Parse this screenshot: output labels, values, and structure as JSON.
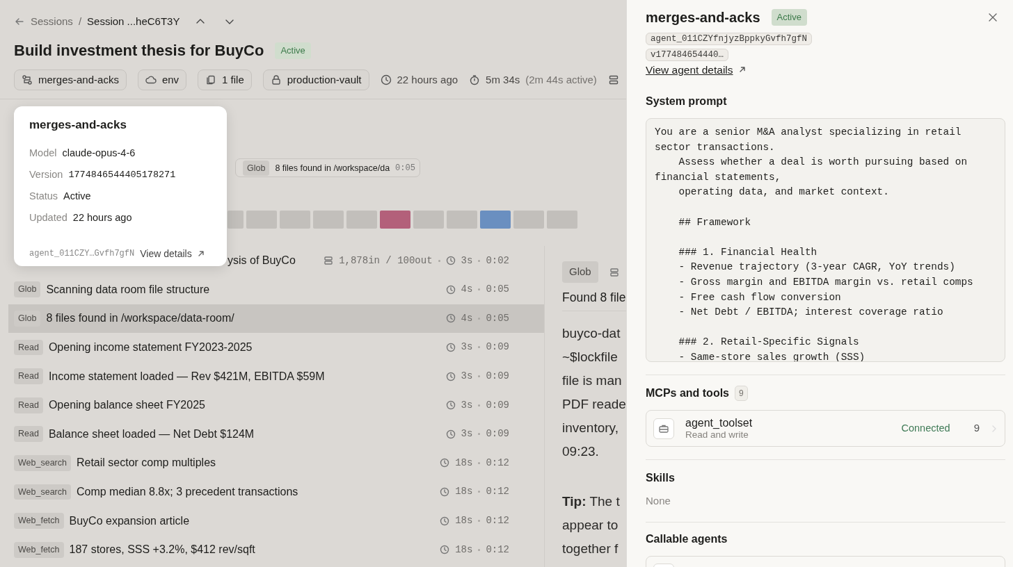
{
  "breadcrumb": {
    "parent": "Sessions",
    "separator": "/",
    "current": "Session ...heC6T3Y"
  },
  "session": {
    "title": "Build investment thesis for BuyCo",
    "status": "Active"
  },
  "chips": [
    {
      "kind": "agent",
      "label": "merges-and-acks"
    },
    {
      "kind": "environment",
      "label": "env"
    },
    {
      "kind": "files",
      "label": "1 file"
    },
    {
      "kind": "vault",
      "label": "production-vault"
    }
  ],
  "meta": [
    {
      "kind": "created",
      "text": "22 hours ago"
    },
    {
      "kind": "duration",
      "text": "5m 34s",
      "note": "(2m 44s active)"
    },
    {
      "kind": "tokens"
    }
  ],
  "timeline": {
    "hover": {
      "tag": "Glob",
      "text": "8 files found in /workspace/da",
      "time": "0:05"
    },
    "segments": [
      {
        "color": "#c2bfbb"
      },
      {
        "color": "#c2bfbb"
      },
      {
        "color": "#c2bfbb"
      },
      {
        "color": "#c2bfbb"
      },
      {
        "color": "#c2bfbb"
      },
      {
        "color": "#b3607a"
      },
      {
        "color": "#c2bfbb"
      },
      {
        "color": "#c2bfbb"
      },
      {
        "color": "#6a8fc0"
      },
      {
        "color": "#c2bfbb"
      },
      {
        "color": "#c2bfbb"
      }
    ]
  },
  "popover": {
    "title": "merges-and-acks",
    "fields": [
      {
        "kind": "text",
        "label": "Model",
        "value": "claude-opus-4-6"
      },
      {
        "kind": "mono",
        "label": "Version",
        "value": "1774846544405178271"
      },
      {
        "kind": "text",
        "label": "Status",
        "value": "Active"
      },
      {
        "kind": "text",
        "label": "Updated",
        "value": "22 hours ago"
      }
    ],
    "agent_id": "agent_011CZY…Gvfh7gfN",
    "link": "View details"
  },
  "log_rows": [
    {
      "title": "ysis of BuyCo",
      "tokens": "1,878in / 100out",
      "duration": "3s",
      "time": "0:02",
      "selected": false
    },
    {
      "tag": "Glob",
      "title": "Scanning data room file structure",
      "duration": "4s",
      "time": "0:05",
      "selected": false
    },
    {
      "tag": "Glob",
      "title": "8 files found in /workspace/data-room/",
      "duration": "4s",
      "time": "0:05",
      "selected": true
    },
    {
      "tag": "Read",
      "title": "Opening income statement FY2023-2025",
      "duration": "3s",
      "time": "0:09",
      "selected": false
    },
    {
      "tag": "Read",
      "title": "Income statement loaded — Rev $421M,  EBITDA $59M",
      "duration": "3s",
      "time": "0:09",
      "selected": false
    },
    {
      "tag": "Read",
      "title": "Opening balance sheet FY2025",
      "duration": "3s",
      "time": "0:09",
      "selected": false
    },
    {
      "tag": "Read",
      "title": "Balance sheet loaded — Net Debt $124M",
      "duration": "3s",
      "time": "0:09",
      "selected": false
    },
    {
      "tag": "Web_search",
      "title": "Retail sector comp multiples",
      "duration": "18s",
      "time": "0:12",
      "selected": false
    },
    {
      "tag": "Web_search",
      "title": "Comp median 8.8x; 3 precedent transactions",
      "duration": "18s",
      "time": "0:12",
      "selected": false
    },
    {
      "tag": "Web_fetch",
      "title": "BuyCo expansion article",
      "duration": "18s",
      "time": "0:12",
      "selected": false
    },
    {
      "tag": "Web_fetch",
      "title": "187 stores,  SSS +3.2%,  $412 rev/sqft",
      "duration": "18s",
      "time": "0:12",
      "selected": false
    }
  ],
  "detail": {
    "tag": "Glob",
    "heading": "Found 8 file",
    "lines": [
      "buyco-dat",
      "~$lockfile",
      "file is man",
      "PDF reade",
      "inventory,",
      "09:23."
    ],
    "tip_lines": [
      "**Tip:** The t",
      "appear to",
      "together f"
    ]
  },
  "drawer": {
    "title": "merges-and-acks",
    "status": "Active",
    "ids": [
      "agent_011CZYfnjyzBppkyGvfh7gfN",
      "v177484654440…"
    ],
    "link": "View agent details",
    "system_prompt": {
      "heading": "System prompt",
      "text": "You are a senior M&A analyst specializing in retail sector transactions.\n    Assess whether a deal is worth pursuing based on financial statements,\n    operating data, and market context.\n\n    ## Framework\n\n    ### 1. Financial Health\n    - Revenue trajectory (3-year CAGR, YoY trends)\n    - Gross margin and EBITDA margin vs. retail comps\n    - Free cash flow conversion\n    - Net Debt / EBITDA; interest coverage ratio\n\n    ### 2. Retail-Specific Signals\n    - Same-store sales growth (SSS)"
    },
    "tools": {
      "heading": "MCPs and tools",
      "count": "9",
      "items": [
        {
          "name": "agent_toolset",
          "access": "Read and write",
          "status": "Connected",
          "count": "9"
        }
      ]
    },
    "skills": {
      "heading": "Skills",
      "empty_text": "None"
    },
    "callable_agents": {
      "heading": "Callable agents"
    }
  }
}
